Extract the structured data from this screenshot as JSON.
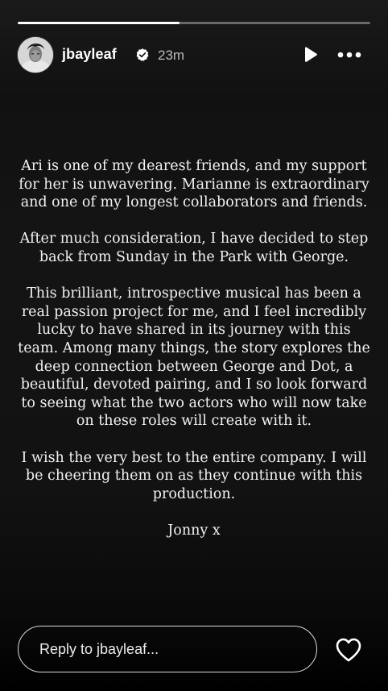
{
  "story": {
    "progress_fraction": 0.46
  },
  "header": {
    "username": "jbayleaf",
    "verified_icon": "verified-badge-icon",
    "timestamp": "23m",
    "play_icon": "play-icon",
    "more_icon": "more-options-icon"
  },
  "statement": {
    "paragraphs": [
      "Ari is one of my dearest friends, and my support for her is unwavering. Marianne is extraordinary and one of my longest collaborators and friends.",
      "After much consideration, I have decided to step back from Sunday in the Park with George.",
      "This brilliant, introspective musical has been a real passion project for me, and I feel incredibly lucky to have shared in its journey with this team. Among many things, the story explores the deep connection between George and Dot, a beautiful, devoted pairing, and I so look forward to seeing what the two actors who will now take on these roles will create with it.",
      "I wish the very best to the entire company. I will be cheering them on as they continue with this production."
    ],
    "signoff": "Jonny x"
  },
  "reply": {
    "placeholder": "Reply to jbayleaf...",
    "value": ""
  },
  "actions": {
    "like_icon": "heart-icon"
  },
  "colors": {
    "background": "#000000",
    "text": "#ffffff"
  }
}
